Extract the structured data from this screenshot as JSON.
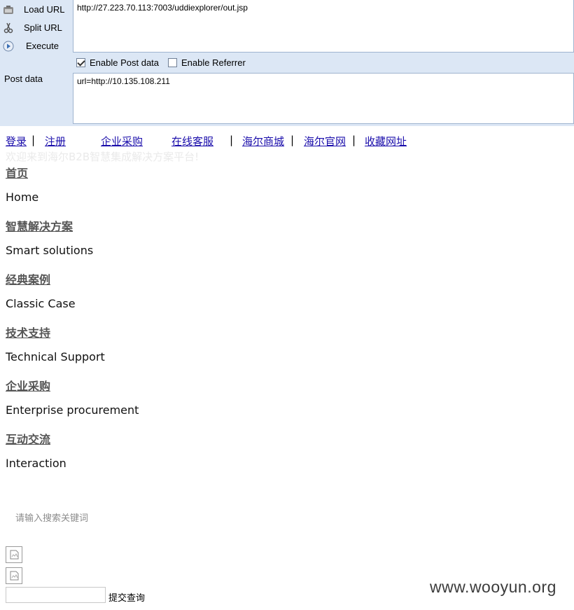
{
  "hackbar": {
    "load_url_label": "Load URL",
    "split_url_label": "Split URL",
    "execute_label": "Execute",
    "url_value": "http://27.223.70.113:7003/uddiexplorer/out.jsp",
    "enable_post_label": "Enable Post data",
    "enable_post_checked": true,
    "enable_referrer_label": "Enable Referrer",
    "enable_referrer_checked": false,
    "post_data_label": "Post data",
    "post_data_value": "url=http://10.135.108.211"
  },
  "topnav": {
    "login": "登录",
    "register": "注册",
    "procurement": "企业采购",
    "service": "在线客服",
    "mall": "海尔商城",
    "official": "海尔官网",
    "bookmark": "收藏网址",
    "separator": "|"
  },
  "welcome_text": "欢迎来到海尔B2B智慧集成解决方案平台!",
  "menu": [
    {
      "zh": "首页",
      "en": "Home"
    },
    {
      "zh": "智慧解决方案",
      "en": "Smart solutions"
    },
    {
      "zh": "经典案例",
      "en": "Classic Case"
    },
    {
      "zh": "技术支持",
      "en": "Technical Support"
    },
    {
      "zh": "企业采购",
      "en": "Enterprise procurement"
    },
    {
      "zh": "互动交流",
      "en": "Interaction"
    }
  ],
  "search": {
    "hint": "请输入搜索关键词",
    "submit_label": "提交查询"
  },
  "watermark": "www.wooyun.org"
}
